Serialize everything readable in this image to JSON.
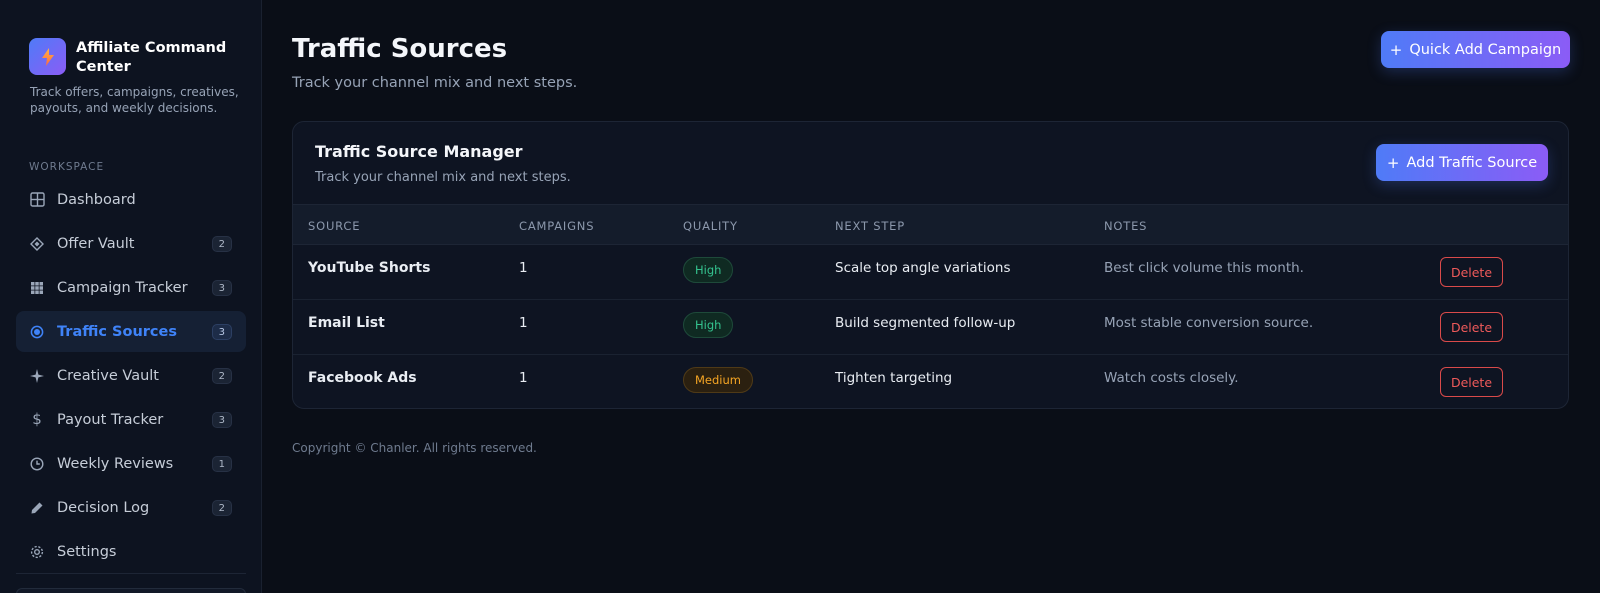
{
  "brand": {
    "title": "Affiliate Command Center",
    "description": "Track offers, campaigns, creatives, payouts, and weekly decisions.",
    "logo_icon": "bolt-icon"
  },
  "sidebar": {
    "section_label": "WORKSPACE",
    "items": [
      {
        "label": "Dashboard",
        "icon": "grid-icon",
        "badge": ""
      },
      {
        "label": "Offer Vault",
        "icon": "diamond-icon",
        "badge": "2"
      },
      {
        "label": "Campaign Tracker",
        "icon": "table-icon",
        "badge": "3"
      },
      {
        "label": "Traffic Sources",
        "icon": "target-icon",
        "badge": "3",
        "active": true
      },
      {
        "label": "Creative Vault",
        "icon": "sparkle-icon",
        "badge": "2"
      },
      {
        "label": "Payout Tracker",
        "icon": "dollar-icon",
        "badge": "3"
      },
      {
        "label": "Weekly Reviews",
        "icon": "clock-icon",
        "badge": "1"
      },
      {
        "label": "Decision Log",
        "icon": "pen-icon",
        "badge": "2"
      },
      {
        "label": "Settings",
        "icon": "gear-icon",
        "badge": ""
      }
    ]
  },
  "header": {
    "title": "Traffic Sources",
    "subtitle": "Track your channel mix and next steps.",
    "quick_add_label": "Quick Add Campaign"
  },
  "manager": {
    "title": "Traffic Source Manager",
    "subtitle": "Track your channel mix and next steps.",
    "add_label": "Add Traffic Source",
    "columns": {
      "source": "SOURCE",
      "campaigns": "CAMPAIGNS",
      "quality": "QUALITY",
      "next_step": "NEXT STEP",
      "notes": "NOTES"
    },
    "rows": [
      {
        "source": "YouTube Shorts",
        "campaigns": "1",
        "quality": "High",
        "next_step": "Scale top angle variations",
        "notes": "Best click volume this month.",
        "delete": "Delete"
      },
      {
        "source": "Email List",
        "campaigns": "1",
        "quality": "High",
        "next_step": "Build segmented follow-up",
        "notes": "Most stable conversion source.",
        "delete": "Delete"
      },
      {
        "source": "Facebook Ads",
        "campaigns": "1",
        "quality": "Medium",
        "next_step": "Tighten targeting",
        "notes": "Watch costs closely.",
        "delete": "Delete"
      }
    ]
  },
  "footer": {
    "copyright": "Copyright © Chanler. All rights reserved."
  },
  "colors": {
    "accent": "#3f83f8",
    "gradient_start": "#4f7bf7",
    "gradient_end": "#8b5cf6",
    "danger": "#ef5a5a",
    "quality_high": "#34c38f",
    "quality_medium": "#f5a524"
  }
}
